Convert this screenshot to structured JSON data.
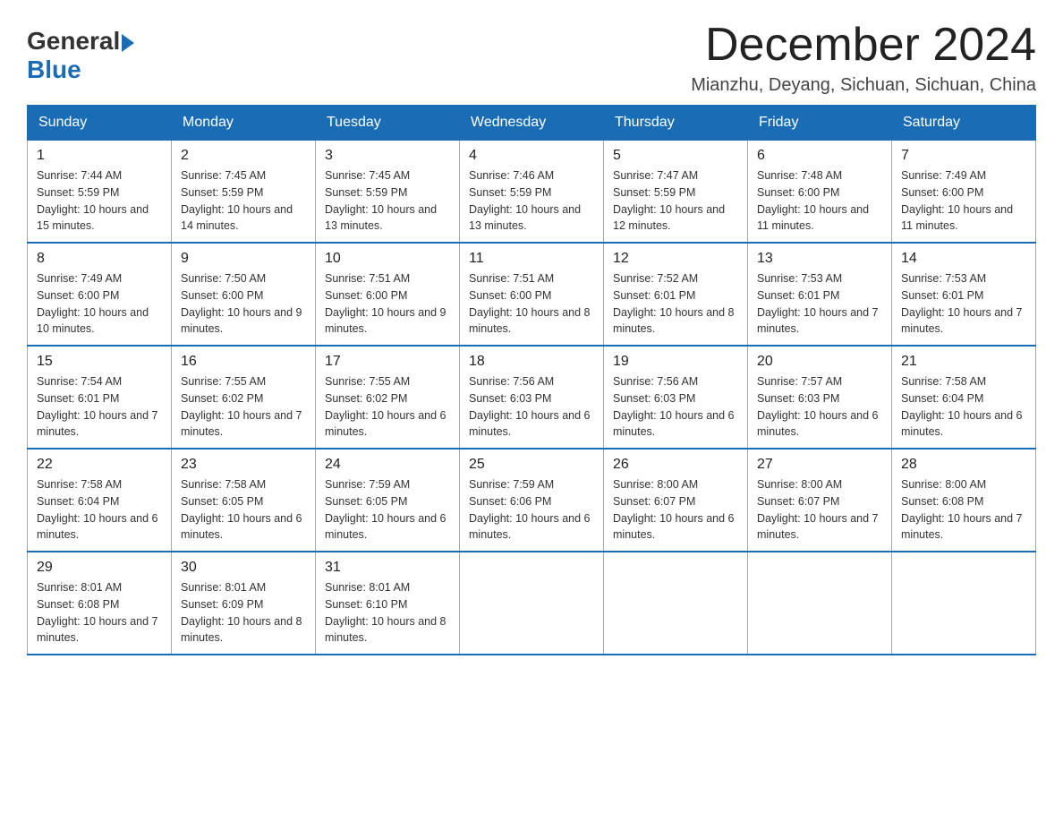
{
  "header": {
    "logo_general": "General",
    "logo_blue": "Blue",
    "month_title": "December 2024",
    "location": "Mianzhu, Deyang, Sichuan, Sichuan, China"
  },
  "days_of_week": [
    "Sunday",
    "Monday",
    "Tuesday",
    "Wednesday",
    "Thursday",
    "Friday",
    "Saturday"
  ],
  "weeks": [
    [
      {
        "day": "1",
        "sunrise": "7:44 AM",
        "sunset": "5:59 PM",
        "daylight": "10 hours and 15 minutes."
      },
      {
        "day": "2",
        "sunrise": "7:45 AM",
        "sunset": "5:59 PM",
        "daylight": "10 hours and 14 minutes."
      },
      {
        "day": "3",
        "sunrise": "7:45 AM",
        "sunset": "5:59 PM",
        "daylight": "10 hours and 13 minutes."
      },
      {
        "day": "4",
        "sunrise": "7:46 AM",
        "sunset": "5:59 PM",
        "daylight": "10 hours and 13 minutes."
      },
      {
        "day": "5",
        "sunrise": "7:47 AM",
        "sunset": "5:59 PM",
        "daylight": "10 hours and 12 minutes."
      },
      {
        "day": "6",
        "sunrise": "7:48 AM",
        "sunset": "6:00 PM",
        "daylight": "10 hours and 11 minutes."
      },
      {
        "day": "7",
        "sunrise": "7:49 AM",
        "sunset": "6:00 PM",
        "daylight": "10 hours and 11 minutes."
      }
    ],
    [
      {
        "day": "8",
        "sunrise": "7:49 AM",
        "sunset": "6:00 PM",
        "daylight": "10 hours and 10 minutes."
      },
      {
        "day": "9",
        "sunrise": "7:50 AM",
        "sunset": "6:00 PM",
        "daylight": "10 hours and 9 minutes."
      },
      {
        "day": "10",
        "sunrise": "7:51 AM",
        "sunset": "6:00 PM",
        "daylight": "10 hours and 9 minutes."
      },
      {
        "day": "11",
        "sunrise": "7:51 AM",
        "sunset": "6:00 PM",
        "daylight": "10 hours and 8 minutes."
      },
      {
        "day": "12",
        "sunrise": "7:52 AM",
        "sunset": "6:01 PM",
        "daylight": "10 hours and 8 minutes."
      },
      {
        "day": "13",
        "sunrise": "7:53 AM",
        "sunset": "6:01 PM",
        "daylight": "10 hours and 7 minutes."
      },
      {
        "day": "14",
        "sunrise": "7:53 AM",
        "sunset": "6:01 PM",
        "daylight": "10 hours and 7 minutes."
      }
    ],
    [
      {
        "day": "15",
        "sunrise": "7:54 AM",
        "sunset": "6:01 PM",
        "daylight": "10 hours and 7 minutes."
      },
      {
        "day": "16",
        "sunrise": "7:55 AM",
        "sunset": "6:02 PM",
        "daylight": "10 hours and 7 minutes."
      },
      {
        "day": "17",
        "sunrise": "7:55 AM",
        "sunset": "6:02 PM",
        "daylight": "10 hours and 6 minutes."
      },
      {
        "day": "18",
        "sunrise": "7:56 AM",
        "sunset": "6:03 PM",
        "daylight": "10 hours and 6 minutes."
      },
      {
        "day": "19",
        "sunrise": "7:56 AM",
        "sunset": "6:03 PM",
        "daylight": "10 hours and 6 minutes."
      },
      {
        "day": "20",
        "sunrise": "7:57 AM",
        "sunset": "6:03 PM",
        "daylight": "10 hours and 6 minutes."
      },
      {
        "day": "21",
        "sunrise": "7:58 AM",
        "sunset": "6:04 PM",
        "daylight": "10 hours and 6 minutes."
      }
    ],
    [
      {
        "day": "22",
        "sunrise": "7:58 AM",
        "sunset": "6:04 PM",
        "daylight": "10 hours and 6 minutes."
      },
      {
        "day": "23",
        "sunrise": "7:58 AM",
        "sunset": "6:05 PM",
        "daylight": "10 hours and 6 minutes."
      },
      {
        "day": "24",
        "sunrise": "7:59 AM",
        "sunset": "6:05 PM",
        "daylight": "10 hours and 6 minutes."
      },
      {
        "day": "25",
        "sunrise": "7:59 AM",
        "sunset": "6:06 PM",
        "daylight": "10 hours and 6 minutes."
      },
      {
        "day": "26",
        "sunrise": "8:00 AM",
        "sunset": "6:07 PM",
        "daylight": "10 hours and 6 minutes."
      },
      {
        "day": "27",
        "sunrise": "8:00 AM",
        "sunset": "6:07 PM",
        "daylight": "10 hours and 7 minutes."
      },
      {
        "day": "28",
        "sunrise": "8:00 AM",
        "sunset": "6:08 PM",
        "daylight": "10 hours and 7 minutes."
      }
    ],
    [
      {
        "day": "29",
        "sunrise": "8:01 AM",
        "sunset": "6:08 PM",
        "daylight": "10 hours and 7 minutes."
      },
      {
        "day": "30",
        "sunrise": "8:01 AM",
        "sunset": "6:09 PM",
        "daylight": "10 hours and 8 minutes."
      },
      {
        "day": "31",
        "sunrise": "8:01 AM",
        "sunset": "6:10 PM",
        "daylight": "10 hours and 8 minutes."
      },
      null,
      null,
      null,
      null
    ]
  ]
}
